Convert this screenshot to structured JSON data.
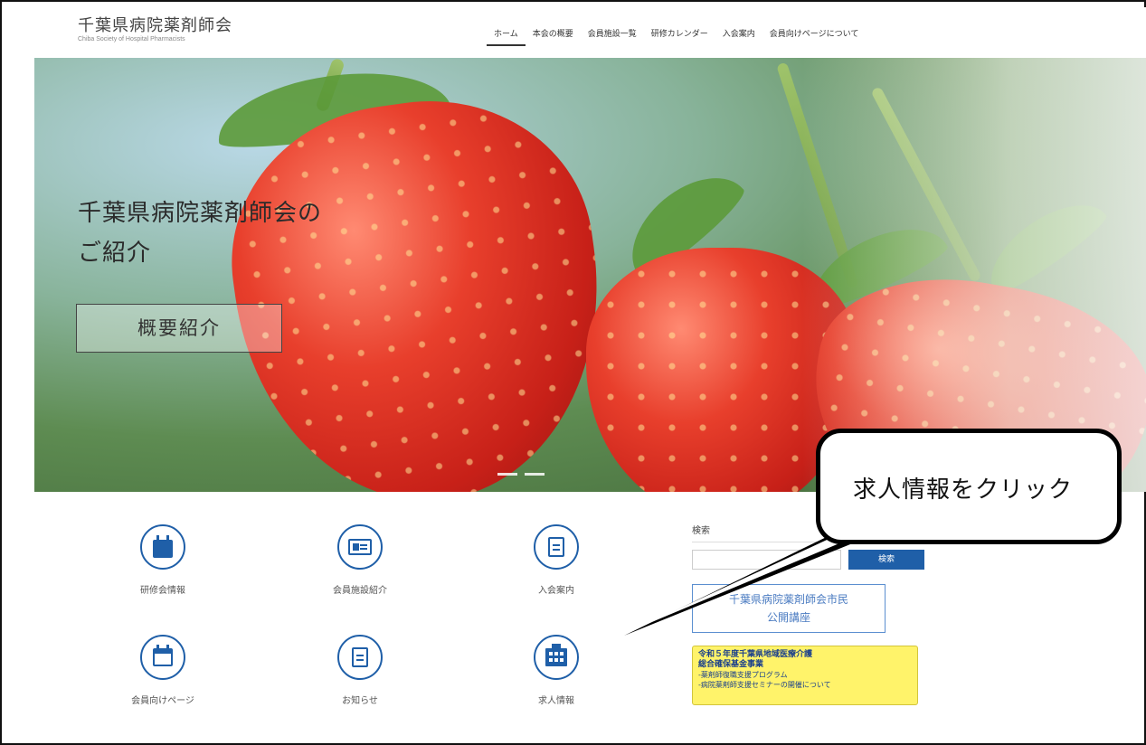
{
  "header": {
    "logo_title": "千葉県病院薬剤師会",
    "logo_subtitle": "Chiba Society of Hospital Pharmacists",
    "nav": [
      {
        "label": "ホーム",
        "active": true
      },
      {
        "label": "本会の概要",
        "active": false
      },
      {
        "label": "会員施設一覧",
        "active": false
      },
      {
        "label": "研修カレンダー",
        "active": false
      },
      {
        "label": "入会案内",
        "active": false
      },
      {
        "label": "会員向けページについて",
        "active": false
      }
    ]
  },
  "hero": {
    "title_line1": "千葉県病院薬剤師会の",
    "title_line2": "ご紹介",
    "button_label": "概要紹介"
  },
  "grid": [
    {
      "label": "研修会情報",
      "icon": "calendar-icon"
    },
    {
      "label": "会員施設紹介",
      "icon": "id-card-icon"
    },
    {
      "label": "入会案内",
      "icon": "document-icon"
    },
    {
      "label": "会員向けページ",
      "icon": "calendar-outline-icon"
    },
    {
      "label": "お知らせ",
      "icon": "document-icon"
    },
    {
      "label": "求人情報",
      "icon": "building-icon"
    }
  ],
  "sidebar": {
    "search_heading": "検索",
    "search_placeholder": "",
    "search_button": "検索",
    "lecture_line1": "千葉県病院薬剤師会市民",
    "lecture_line2": "公開講座",
    "banner_title1": "令和５年度千葉県地域医療介護",
    "banner_title2": "総合確保基金事業",
    "banner_item1": "-薬剤師復職支援プログラム",
    "banner_item2": "-病院薬剤師支援セミナーの開催について"
  },
  "callout": {
    "text": "求人情報をクリック"
  },
  "colors": {
    "accent_blue": "#1f5fa8",
    "banner_yellow": "#fff36a"
  }
}
